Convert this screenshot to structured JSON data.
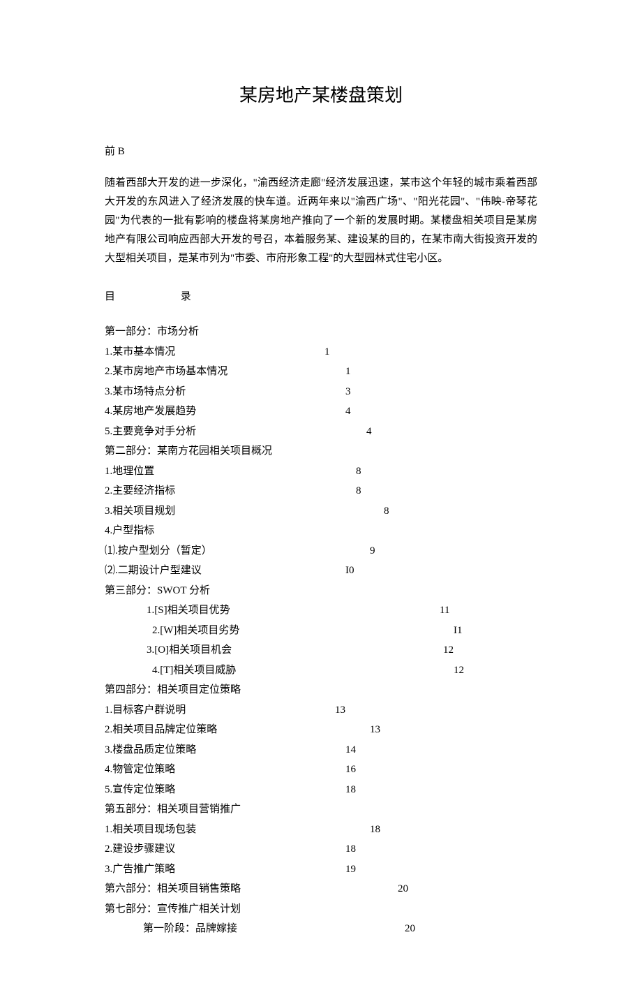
{
  "title": "某房地产某楼盘策划",
  "preface_label": "前 B",
  "preface_body": "随着西部大开发的进一步深化，\"渝西经济走廊\"经济发展迅速，某市这个年轻的城市乘着西部大开发的东风进入了经济发展的快车道。近两年来以\"渝西广场\"、\"阳光花园\"、\"伟映-帝琴花园\"为代表的一批有影响的楼盘将某房地产推向了一个新的发展时期。某楼盘相关项目是某房地产有限公司响应西部大开发的号召，本着服务某、建设某的目的，在某市南大街投资开发的大型相关项目，是某市列为\"市委、市府形象工程\"的大型园林式住宅小区。",
  "toc_label_1": "目",
  "toc_label_2": "录",
  "toc": [
    {
      "text": "第一部分：市场分析",
      "page": "",
      "indent": 1,
      "text_pad": 0,
      "page_col": 0
    },
    {
      "text": "1.某市基本情况",
      "page": "1",
      "indent": 1,
      "text_pad": 0,
      "page_col": 315
    },
    {
      "text": "2.某市房地产市场基本情况",
      "page": "1",
      "indent": 1,
      "text_pad": 0,
      "page_col": 345
    },
    {
      "text": "3.某市场特点分析",
      "page": "3",
      "indent": 1,
      "text_pad": 0,
      "page_col": 345
    },
    {
      "text": "4.某房地产发展趋势",
      "page": "4",
      "indent": 1,
      "text_pad": 0,
      "page_col": 345
    },
    {
      "text": "5.主要竞争对手分析",
      "page": "4",
      "indent": 1,
      "text_pad": 0,
      "page_col": 375
    },
    {
      "text": "第二部分：某南方花园相关项目概况",
      "page": "",
      "indent": 1,
      "text_pad": 0,
      "page_col": 0
    },
    {
      "text": "1.地理位置",
      "page": "8",
      "indent": 1,
      "text_pad": 0,
      "page_col": 360
    },
    {
      "text": "2.主要经济指标",
      "page": "8",
      "indent": 1,
      "text_pad": 0,
      "page_col": 360
    },
    {
      "text": "3.相关项目规划",
      "page": "8",
      "indent": 1,
      "text_pad": 0,
      "page_col": 400
    },
    {
      "text": "4.户型指标",
      "page": "",
      "indent": 1,
      "text_pad": 0,
      "page_col": 0
    },
    {
      "text": "⑴.按户型划分（暂定）",
      "page": "9",
      "indent": 1,
      "text_pad": 0,
      "page_col": 380
    },
    {
      "text": "⑵.二期设计户型建议",
      "page": "I0",
      "indent": 1,
      "text_pad": 0,
      "page_col": 345
    },
    {
      "text": "第三部分：SWOT 分析",
      "page": "",
      "indent": 1,
      "text_pad": 0,
      "page_col": 0
    },
    {
      "text": "1.[S]相关项目优势",
      "page": "11",
      "indent": 2,
      "text_pad": 0,
      "page_col": 480
    },
    {
      "text": "2.[W]相关项目劣势",
      "page": "I1",
      "indent": 2,
      "text_pad": 8,
      "page_col": 500
    },
    {
      "text": "3.[O]相关项目机会",
      "page": "12",
      "indent": 2,
      "text_pad": 0,
      "page_col": 485
    },
    {
      "text": "4.[T]相关项目威胁",
      "page": "12",
      "indent": 2,
      "text_pad": 8,
      "page_col": 500
    },
    {
      "text": "第四部分：相关项目定位策略",
      "page": "",
      "indent": 1,
      "text_pad": 0,
      "page_col": 0
    },
    {
      "text": "1.目标客户群说明",
      "page": "13",
      "indent": 1,
      "text_pad": 0,
      "page_col": 330
    },
    {
      "text": "2.相关项目品牌定位策略",
      "page": "13",
      "indent": 1,
      "text_pad": 0,
      "page_col": 380
    },
    {
      "text": "3.楼盘品质定位策略",
      "page": "14",
      "indent": 1,
      "text_pad": 0,
      "page_col": 345
    },
    {
      "text": "4.物管定位策略",
      "page": "16",
      "indent": 1,
      "text_pad": 0,
      "page_col": 345
    },
    {
      "text": "5.宣传定位策略",
      "page": "18",
      "indent": 1,
      "text_pad": 0,
      "page_col": 345
    },
    {
      "text": "第五部分：相关项目营销推广",
      "page": "",
      "indent": 1,
      "text_pad": 0,
      "page_col": 0
    },
    {
      "text": "1.相关项目现场包装",
      "page": "18",
      "indent": 1,
      "text_pad": 0,
      "page_col": 380
    },
    {
      "text": "2.建设步骤建议",
      "page": "18",
      "indent": 1,
      "text_pad": 0,
      "page_col": 345
    },
    {
      "text": "3.广告推广策略",
      "page": "19",
      "indent": 1,
      "text_pad": 0,
      "page_col": 345
    },
    {
      "text": "第六部分：相关项目销售策略",
      "page": "20",
      "indent": 1,
      "text_pad": 0,
      "page_col": 420
    },
    {
      "text": "第七部分：宣传推广相关计划",
      "page": "",
      "indent": 1,
      "text_pad": 0,
      "page_col": 0
    },
    {
      "text": "第一阶段：品牌嫁接",
      "page": "20",
      "indent": 3,
      "text_pad": 0,
      "page_col": 430
    }
  ]
}
